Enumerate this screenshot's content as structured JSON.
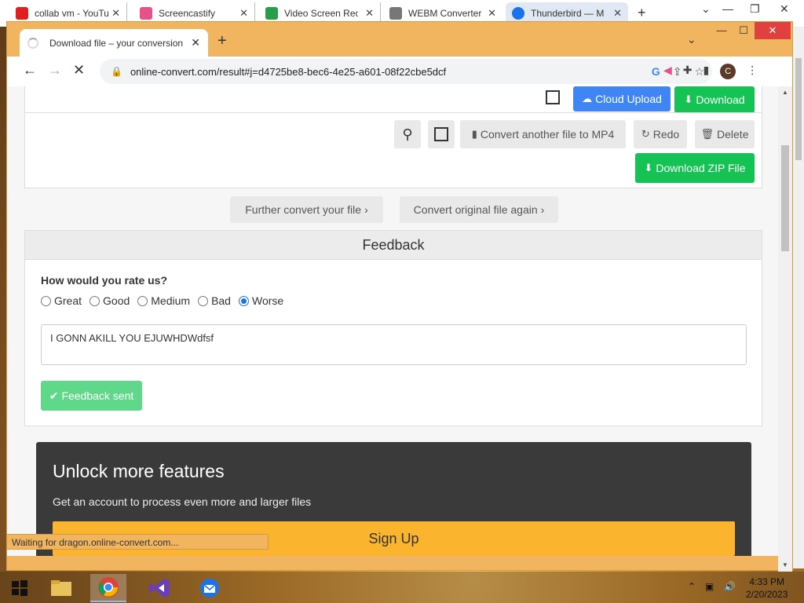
{
  "outer_browser": {
    "tabs": [
      {
        "label": "collab vm - YouTube",
        "color": "#e02020"
      },
      {
        "label": "Screencastify",
        "color": "#e8508a"
      },
      {
        "label": "Video Screen Recorder",
        "color": "#2a9d4a"
      },
      {
        "label": "WEBM Converter",
        "color": "#777777"
      },
      {
        "label": "Thunderbird — M",
        "color": "#1a73e8"
      }
    ]
  },
  "window": {
    "tab_title": "Download file – your conversion",
    "url": "online-convert.com/result#j=d4725be8-bec6-4e25-a601-08f22cbe5dcf",
    "avatar_letter": "C"
  },
  "top_card": {
    "cloud_upload": "Cloud Upload",
    "download": "Download"
  },
  "actions": {
    "convert_another": "Convert another file to MP4",
    "redo": "Redo",
    "delete": "Delete",
    "download_zip": "Download ZIP File"
  },
  "further": {
    "further_convert": "Further convert your file",
    "convert_again": "Convert original file again"
  },
  "feedback": {
    "title": "Feedback",
    "question": "How would you rate us?",
    "options": [
      "Great",
      "Good",
      "Medium",
      "Bad",
      "Worse"
    ],
    "selected": "Worse",
    "text": "I GONN AKILL YOU EJUWHDWdfsf",
    "sent_label": "Feedback sent"
  },
  "unlock": {
    "title": "Unlock more features",
    "subtitle": "Get an account to process even more and larger files",
    "signup": "Sign Up"
  },
  "status_text": "Waiting for dragon.online-convert.com...",
  "taskbar": {
    "time": "4:33 PM",
    "date": "2/20/2023"
  },
  "colors": {
    "accent_green": "#15c254",
    "accent_blue": "#3f86f4",
    "signup_yellow": "#fbb42e",
    "window_frame": "#f1b560"
  }
}
